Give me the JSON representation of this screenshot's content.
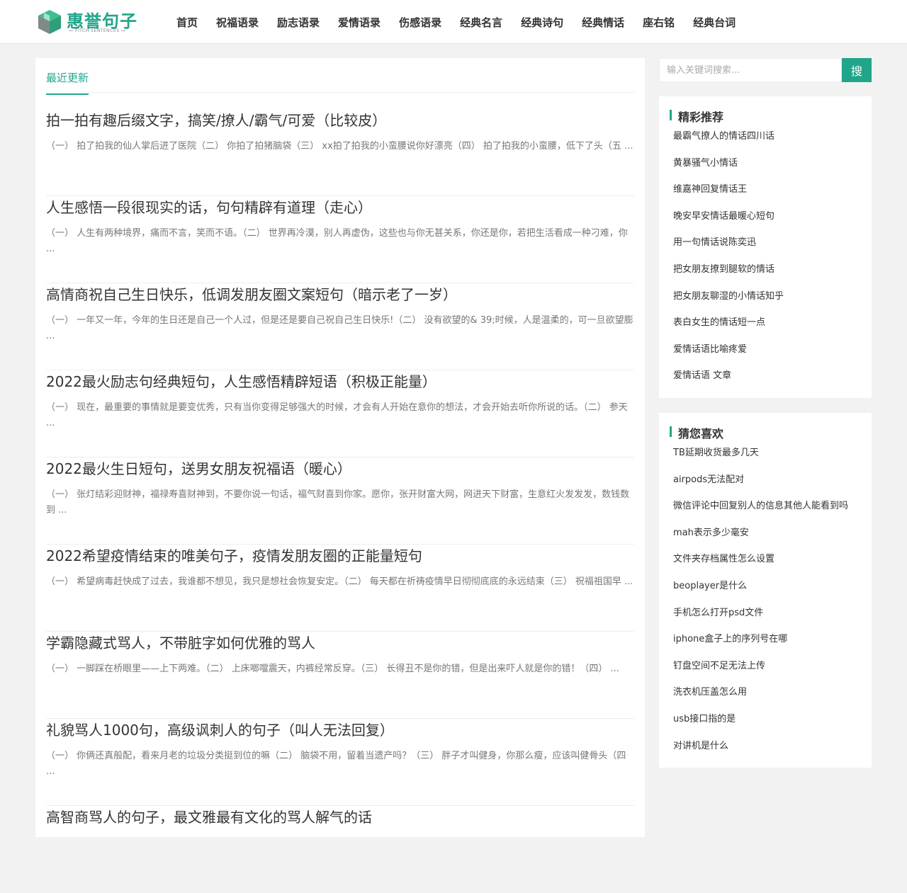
{
  "logo": {
    "title": "惠誉句子",
    "subtitle": "FITCH SENTENCES"
  },
  "nav": {
    "items": [
      "首页",
      "祝福语录",
      "励志语录",
      "爱情语录",
      "伤感语录",
      "经典名言",
      "经典诗句",
      "经典情话",
      "座右铭",
      "经典台词"
    ]
  },
  "main": {
    "tab_label": "最近更新",
    "articles": [
      {
        "title": "拍一拍有趣后缀文字，搞笑/撩人/霸气/可爱（比较皮）",
        "excerpt": "（一） 拍了拍我的仙人掌后进了医院（二） 你拍了拍猪脑袋（三） xx拍了拍我的小蛮腰说你好漂亮（四） 拍了拍我的小蛮腰，低下了头（五 ..."
      },
      {
        "title": "人生感悟一段很现实的话，句句精辟有道理（走心）",
        "excerpt": "（一） 人生有两种境界，痛而不言，笑而不语。（二） 世界再冷漠，别人再虚伪，这些也与你无甚关系，你还是你，若把生活看成一种刁难，你 ..."
      },
      {
        "title": "高情商祝自己生日快乐，低调发朋友圈文案短句（暗示老了一岁）",
        "excerpt": "（一） 一年又一年，今年的生日还是自己一个人过，但是还是要自己祝自己生日快乐!（二） 没有欲望的& 39;时候，人是温柔的，可一旦欲望膨 ..."
      },
      {
        "title": "2022最火励志句经典短句，人生感悟精辟短语（积极正能量）",
        "excerpt": "（一） 现在，最重要的事情就是要变优秀，只有当你变得足够强大的时候，才会有人开始在意你的想法，才会开始去听你所说的话。（二） 参天 ..."
      },
      {
        "title": "2022最火生日短句，送男女朋友祝福语（暖心）",
        "excerpt": "（一） 张灯结彩迎财神，福禄寿喜财神到，不要你说一句话，福气财喜到你家。愿你，张开财富大网，网进天下财富，生意红火发发发，数钱数到 ..."
      },
      {
        "title": "2022希望疫情结束的唯美句子，疫情发朋友圈的正能量短句",
        "excerpt": "（一） 希望病毒赶快成了过去，我谁都不想见，我只是想社会恢复安定。（二） 每天都在祈祷疫情早日彻彻底底的永远结束（三） 祝福祖国早 ..."
      },
      {
        "title": "学霸隐藏式骂人，不带脏字如何优雅的骂人",
        "excerpt": "（一） 一脚踩在桥眼里——上下两难。（二） 上床啷噹震天，内裤经常反穿。（三） 长得丑不是你的错，但是出来吓人就是你的错！（四） ..."
      },
      {
        "title": "礼貌骂人1000句，高级讽刺人的句子（叫人无法回复）",
        "excerpt": "（一） 你俩还真般配，看来月老的垃圾分类挺到位的嘛（二） 脑袋不用，留着当遗产吗？（三） 胖子才叫健身，你那么瘦，应该叫健骨头（四 ..."
      },
      {
        "title": "高智商骂人的句子，最文雅最有文化的骂人解气的话",
        "excerpt": ""
      }
    ]
  },
  "search": {
    "placeholder": "输入关键词搜索...",
    "button_label": "搜"
  },
  "recommended": {
    "title": "精彩推荐",
    "items": [
      "最霸气撩人的情话四川话",
      "黄暴骚气小情话",
      "维嘉神回复情话王",
      "晚安早安情话最暖心短句",
      "用一句情话说陈奕迅",
      "把女朋友撩到腿软的情话",
      "把女朋友聊湿的小情话知乎",
      "表白女生的情话短一点",
      "爱情话语比喻疼爱",
      "爱情话语 文章"
    ]
  },
  "guess": {
    "title": "猜您喜欢",
    "items": [
      "TB延期收货最多几天",
      "airpods无法配对",
      "微信评论中回复别人的信息其他人能看到吗",
      "mah表示多少毫安",
      "文件夹存档属性怎么设置",
      "beoplayer是什么",
      "手机怎么打开psd文件",
      "iphone盒子上的序列号在哪",
      "钉盘空间不足无法上传",
      "洗衣机压盖怎么用",
      "usb接口指的是",
      "对讲机是什么"
    ]
  },
  "colors": {
    "accent": "#20a58a",
    "background": "#f2f2f2"
  }
}
